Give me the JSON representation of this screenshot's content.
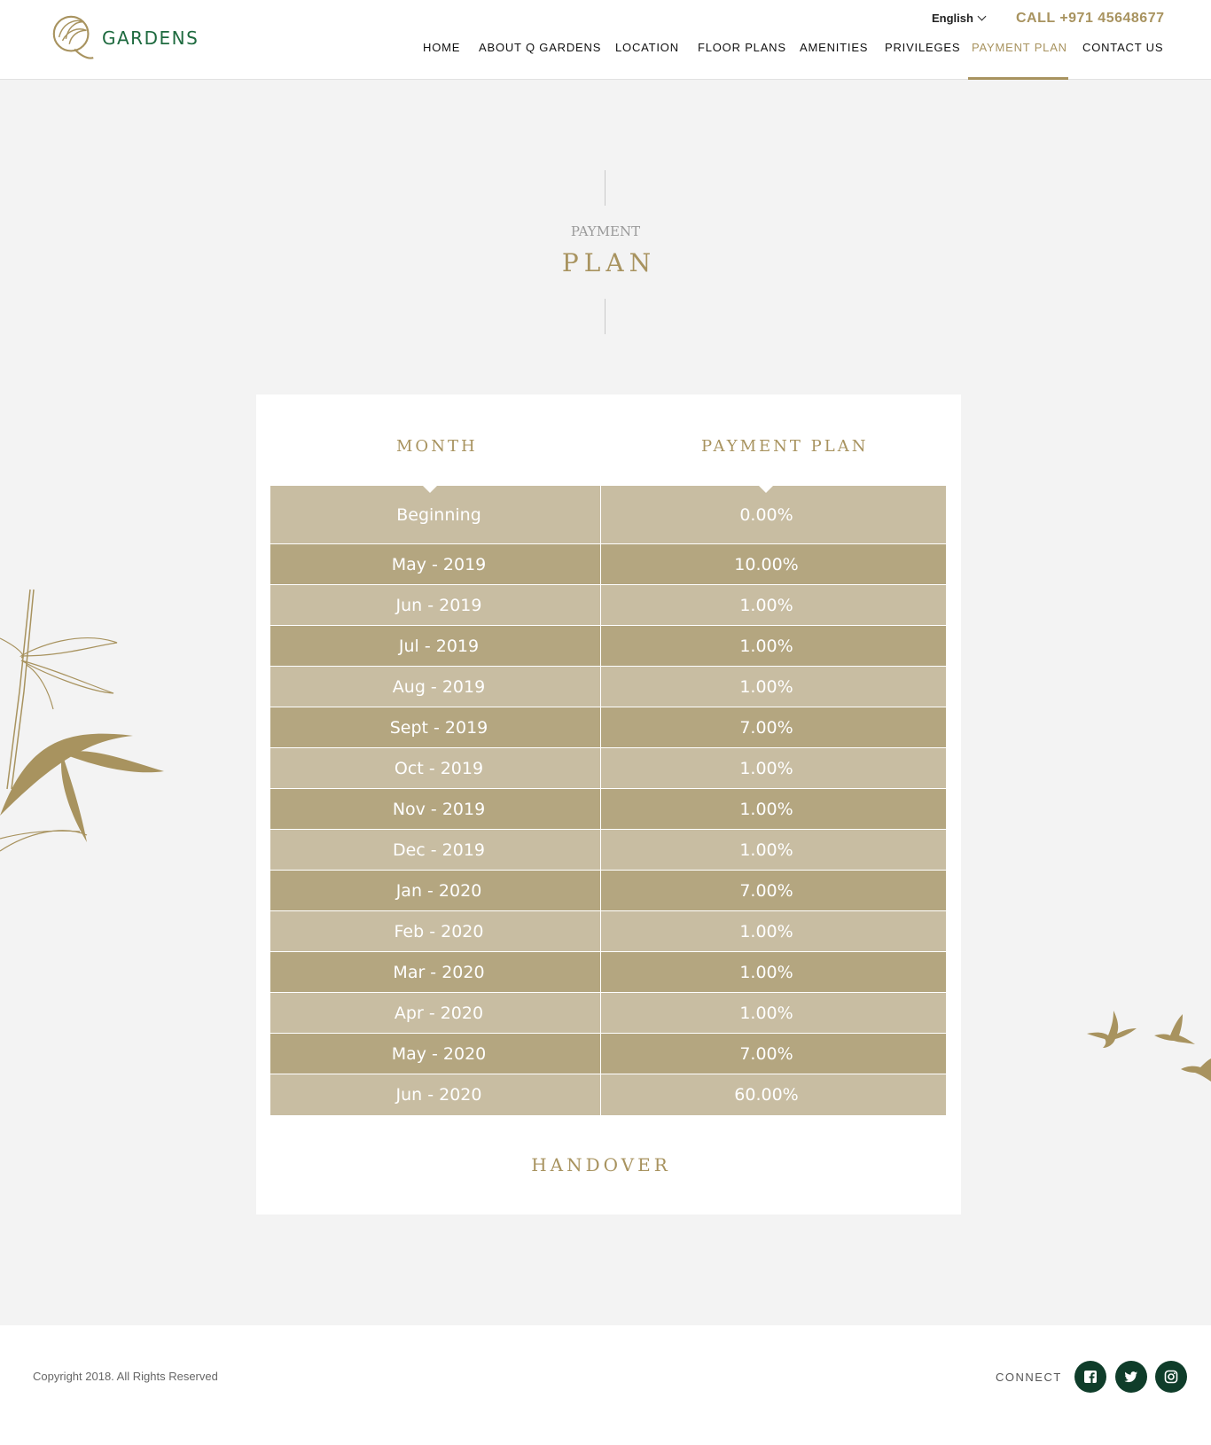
{
  "header": {
    "logo_text": "GARDENS",
    "language": "English",
    "call": "CALL +971 45648677",
    "nav": [
      {
        "label": "HOME"
      },
      {
        "label": "ABOUT Q GARDENS"
      },
      {
        "label": "LOCATION"
      },
      {
        "label": "FLOOR PLANS"
      },
      {
        "label": "AMENITIES"
      },
      {
        "label": "PRIVILEGES"
      },
      {
        "label": "PAYMENT PLAN"
      },
      {
        "label": "CONTACT US"
      }
    ],
    "active_nav": "PAYMENT PLAN"
  },
  "page_title": {
    "small": "PAYMENT",
    "big": "PLAN"
  },
  "table": {
    "col_month": "MONTH",
    "col_plan": "PAYMENT PLAN",
    "rows": [
      {
        "month": "Beginning",
        "plan": "0.00%"
      },
      {
        "month": "May - 2019",
        "plan": "10.00%"
      },
      {
        "month": "Jun - 2019",
        "plan": "1.00%"
      },
      {
        "month": "Jul - 2019",
        "plan": "1.00%"
      },
      {
        "month": "Aug - 2019",
        "plan": "1.00%"
      },
      {
        "month": "Sept - 2019",
        "plan": "7.00%"
      },
      {
        "month": "Oct - 2019",
        "plan": "1.00%"
      },
      {
        "month": "Nov - 2019",
        "plan": "1.00%"
      },
      {
        "month": "Dec - 2019",
        "plan": "1.00%"
      },
      {
        "month": "Jan - 2020",
        "plan": "7.00%"
      },
      {
        "month": "Feb - 2020",
        "plan": "1.00%"
      },
      {
        "month": "Mar - 2020",
        "plan": "1.00%"
      },
      {
        "month": "Apr - 2020",
        "plan": "1.00%"
      },
      {
        "month": "May - 2020",
        "plan": "7.00%"
      },
      {
        "month": "Jun - 2020",
        "plan": "60.00%"
      }
    ],
    "handover": "HANDOVER"
  },
  "footer": {
    "copyright": "Copyright 2018. All Rights Reserved",
    "connect": "CONNECT",
    "social_icons": [
      "facebook-icon",
      "twitter-icon",
      "instagram-icon"
    ]
  },
  "colors": {
    "accent": "#a8935f",
    "brand_green": "#1e6a3f",
    "row_light": "#c8bda2",
    "row_dark": "#b4a680",
    "social_bg": "#0f3d2a"
  }
}
